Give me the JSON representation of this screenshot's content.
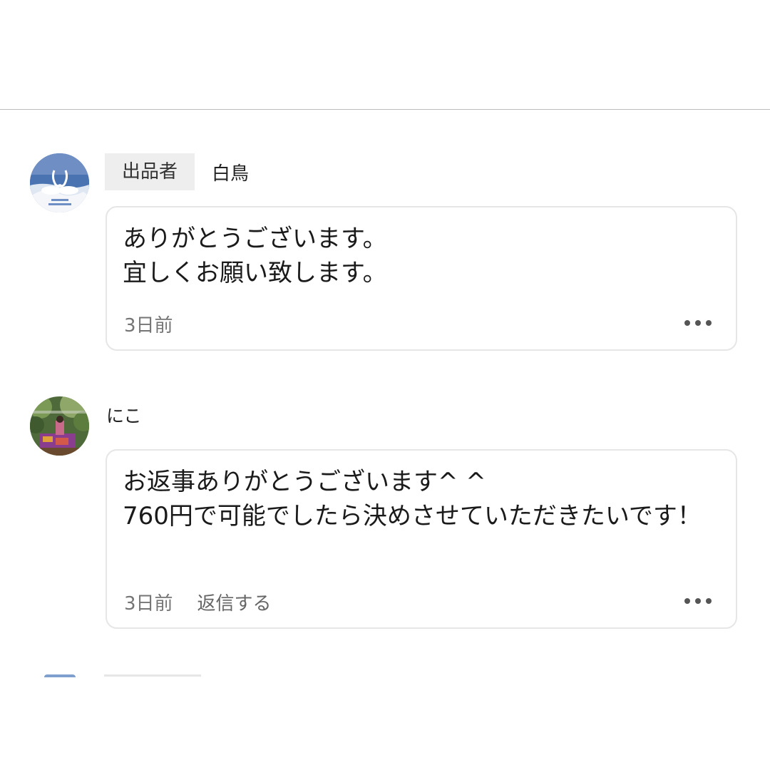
{
  "comments": [
    {
      "badge": "出品者",
      "author": "白鳥",
      "text": "ありがとうございます。\n宜しくお願い致します。",
      "time": "3日前",
      "reply_label": ""
    },
    {
      "badge": "",
      "author": "にこ",
      "text": "お返事ありがとうございます^ ^\n760円で可能でしたら決めさせていただきたいです！",
      "time": "3日前",
      "reply_label": "返信する"
    }
  ],
  "icons": {
    "more": "more-horizontal-icon",
    "avatar_seller": "swan-photo-avatar",
    "avatar_buyer": "garden-photo-avatar"
  },
  "colors": {
    "divider": "#bdbdbd",
    "badge_bg": "#eeeeee",
    "bubble_border": "#e6e6e6",
    "meta_text": "#757575"
  }
}
